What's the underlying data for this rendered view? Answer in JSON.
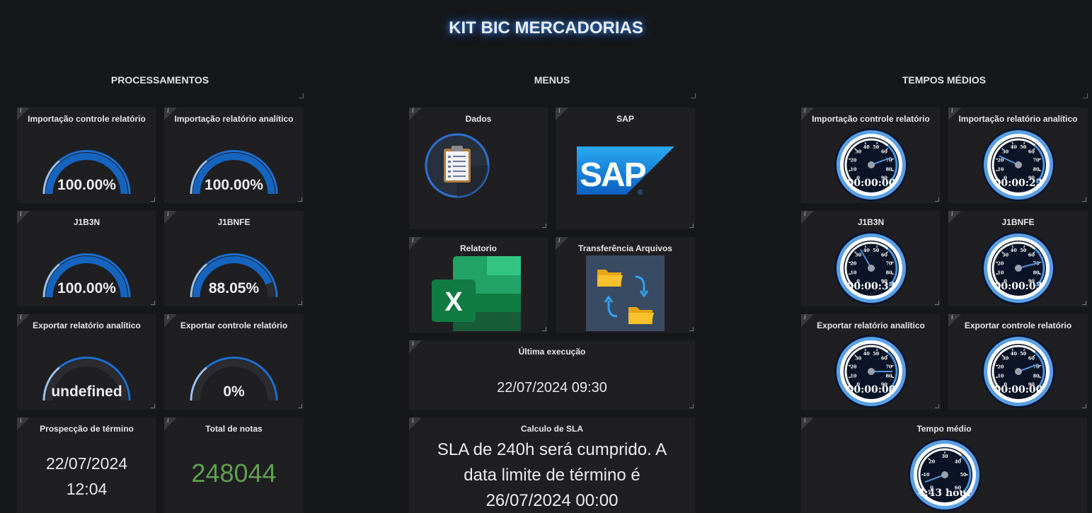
{
  "dashboard_title": "KIT BIC MERCADORIAS",
  "info_glyph": "i",
  "sections": {
    "left": "PROCESSAMENTOS",
    "middle": "MENUS",
    "right": "TEMPOS MÉDIOS"
  },
  "colors": {
    "gauge_blue": "#1565c0",
    "gauge_track": "#2c2c30",
    "green_value": "#5ea04f"
  },
  "processamentos": [
    {
      "title": "Importação controle relatório",
      "value_text": "100.00%",
      "percent": 100
    },
    {
      "title": "Importação relatório analítico",
      "value_text": "100.00%",
      "percent": 100
    },
    {
      "title": "J1B3N",
      "value_text": "100.00%",
      "percent": 100
    },
    {
      "title": "J1BNFE",
      "value_text": "88.05%",
      "percent": 88.05
    },
    {
      "title": "Exportar relatório analítico",
      "value_text": "undefined",
      "percent": 0
    },
    {
      "title": "Exportar controle relatório",
      "value_text": "0%",
      "percent": 0
    }
  ],
  "prospeccao": {
    "title": "Prospecção de término",
    "date": "22/07/2024",
    "time": "12:04"
  },
  "total_notas": {
    "title": "Total de notas",
    "value": "248044"
  },
  "menus": {
    "dados": {
      "title": "Dados",
      "icon": "clipboard-icon"
    },
    "sap": {
      "title": "SAP",
      "logo_text": "SAP",
      "registered": "®"
    },
    "relatorio": {
      "title": "Relatorio",
      "icon": "excel-icon",
      "letter": "X"
    },
    "transferencia": {
      "title": "Transferência Arquivos",
      "icon": "folder-transfer-icon"
    }
  },
  "ultima_execucao": {
    "title": "Última execução",
    "value": "22/07/2024 09:30"
  },
  "sla": {
    "title": "Calculo de SLA",
    "line1": "SLA de 240h será cumprido. A",
    "line2": "data limite de término é",
    "line3": "26/07/2024 00:00"
  },
  "tempos": [
    {
      "title": "Importação controle relatório",
      "value": "00:00:00"
    },
    {
      "title": "Importação relatório analítico",
      "value": "00:00:22"
    },
    {
      "title": "J1B3N",
      "value": "00:00:33"
    },
    {
      "title": "J1BNFE",
      "value": "00:00:03"
    },
    {
      "title": "Exportar relatório analítico",
      "value": "00:00:08"
    },
    {
      "title": "Exportar controle relatório",
      "value": "00:00:00"
    }
  ],
  "speedo_ticks": [
    "0",
    "10",
    "20",
    "30",
    "40",
    "50",
    "60",
    "70",
    "80",
    "90"
  ],
  "tempo_medio": {
    "title": "Tempo médio",
    "value": "4.43 hour",
    "ticks": [
      "0",
      "10",
      "20",
      "30",
      "40",
      "50",
      "60"
    ]
  }
}
